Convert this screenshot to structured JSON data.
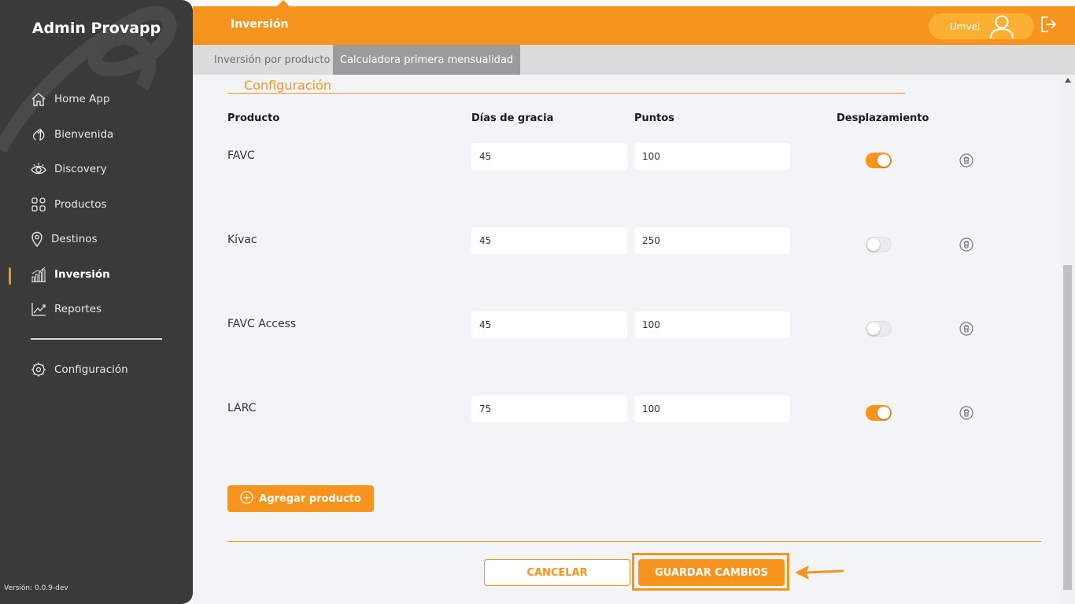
{
  "app": {
    "title": "Admin Provapp",
    "version": "Versión: 0.0.9-dev"
  },
  "sidebar": {
    "items": [
      {
        "label": "Home App",
        "icon": "home-icon"
      },
      {
        "label": "Bienvenida",
        "icon": "wave-hand-icon"
      },
      {
        "label": "Discovery",
        "icon": "eye-icon"
      },
      {
        "label": "Productos",
        "icon": "grid-icon"
      },
      {
        "label": "Destinos",
        "icon": "location-pin-icon"
      },
      {
        "label": "Inversión",
        "icon": "bar-chart-icon",
        "active": true
      },
      {
        "label": "Reportes",
        "icon": "trend-line-icon"
      }
    ],
    "config_item": {
      "label": "Configuración",
      "icon": "gear-icon"
    }
  },
  "header": {
    "section_title": "Inversión",
    "user_name": "Umvel"
  },
  "tabs": [
    {
      "label": "Inversión por producto",
      "active": false
    },
    {
      "label": "Calculadora primera mensualidad",
      "active": true
    }
  ],
  "config": {
    "title": "Configuración",
    "columns": {
      "product": "Producto",
      "grace_days": "Días de gracia",
      "points": "Puntos",
      "displacement": "Desplazamiento"
    },
    "rows": [
      {
        "product": "FAVC",
        "grace_days": "45",
        "points": "100",
        "displacement": true
      },
      {
        "product": "Kívac",
        "grace_days": "45",
        "points": "250",
        "displacement": false
      },
      {
        "product": "FAVC Access",
        "grace_days": "45",
        "points": "100",
        "displacement": false
      },
      {
        "product": "LARC",
        "grace_days": "75",
        "points": "100",
        "displacement": true
      }
    ],
    "add_button": "Agregar producto",
    "cancel_button": "CANCELAR",
    "save_button": "GUARDAR CAMBIOS"
  },
  "colors": {
    "accent": "#f7941d",
    "sidebar_bg": "#3a3a3a",
    "content_bg": "#f3f4f8"
  }
}
